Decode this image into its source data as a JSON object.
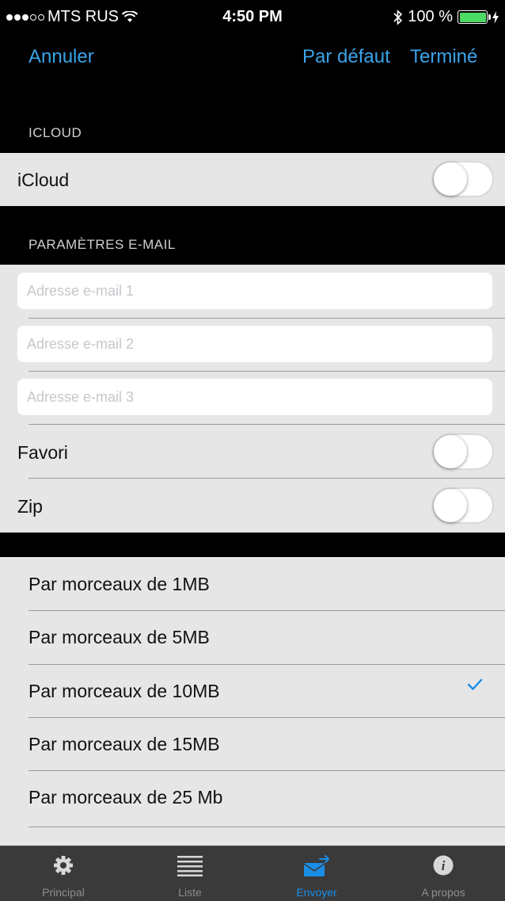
{
  "status_bar": {
    "carrier": "MTS RUS",
    "time": "4:50 PM",
    "battery": "100 %"
  },
  "nav": {
    "cancel": "Annuler",
    "default": "Par défaut",
    "done": "Terminé"
  },
  "icloud_section": {
    "header": "ICLOUD",
    "label": "iCloud",
    "enabled": false
  },
  "email_section": {
    "header": "PARAMÈTRES E-MAIL",
    "fields": [
      {
        "value": "",
        "placeholder": "Adresse e-mail 1"
      },
      {
        "value": "",
        "placeholder": "Adresse e-mail 2"
      },
      {
        "value": "",
        "placeholder": "Adresse e-mail 3"
      }
    ],
    "favori_label": "Favori",
    "favori_enabled": false,
    "zip_label": "Zip",
    "zip_enabled": false
  },
  "chunk_options": {
    "items": [
      {
        "label": "Par morceaux de 1MB",
        "selected": false
      },
      {
        "label": "Par morceaux de 5MB",
        "selected": false
      },
      {
        "label": "Par morceaux de 10MB",
        "selected": true
      },
      {
        "label": "Par morceaux de 15MB",
        "selected": false
      },
      {
        "label": "Par morceaux de 25 Mb",
        "selected": false
      }
    ]
  },
  "tabbar": {
    "tabs": [
      {
        "label": "Principal",
        "icon": "gear-icon",
        "active": false
      },
      {
        "label": "Liste",
        "icon": "list-icon",
        "active": false
      },
      {
        "label": "Envoyer",
        "icon": "send-mail-icon",
        "active": true
      },
      {
        "label": "A propos",
        "icon": "info-icon",
        "active": false
      }
    ]
  },
  "colors": {
    "accent": "#3aa4e8",
    "tab_active": "#1a8ee6",
    "checkmark": "#1a8ee6",
    "battery": "#4cd964"
  }
}
